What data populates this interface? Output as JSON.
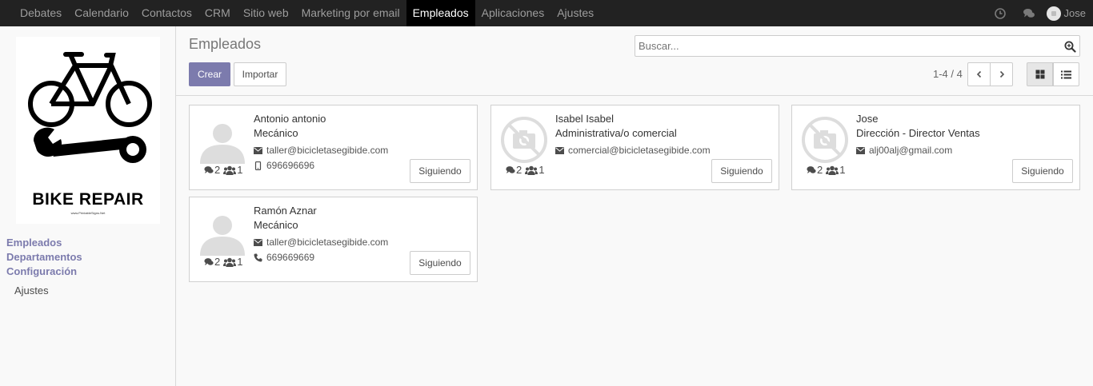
{
  "menu": [
    {
      "label": "Debates"
    },
    {
      "label": "Calendario"
    },
    {
      "label": "Contactos"
    },
    {
      "label": "CRM"
    },
    {
      "label": "Sitio web"
    },
    {
      "label": "Marketing por email"
    },
    {
      "label": "Empleados",
      "active": true
    },
    {
      "label": "Aplicaciones"
    },
    {
      "label": "Ajustes"
    }
  ],
  "topbar": {
    "user_name": "Jose",
    "icons": [
      "clock-icon",
      "chat-icon"
    ]
  },
  "logo": {
    "text": "BIKE REPAIR",
    "small": "www.PrintableSigns.Net"
  },
  "sidebar": {
    "sections": [
      "Empleados",
      "Departamentos",
      "Configuración"
    ],
    "sub_items": [
      "Ajustes"
    ]
  },
  "control": {
    "breadcrumb": "Empleados",
    "search_placeholder": "Buscar...",
    "create_label": "Crear",
    "import_label": "Importar",
    "pager": "1-4 / 4"
  },
  "colors": {
    "brand": "#7c7bad",
    "topbar": "#222222"
  },
  "employees": [
    {
      "name": "Antonio antonio",
      "job": "Mecánico",
      "email": "taller@bicicletasegibide.com",
      "phone": "696696696",
      "phone_icon": "mobile-icon",
      "messages": "2",
      "followers": "1",
      "follow_label": "Siguiendo",
      "photo": "person-silhouette"
    },
    {
      "name": "Isabel Isabel",
      "job": "Administrativa/o comercial",
      "email": "comercial@bicicletasegibide.com",
      "phone": "",
      "messages": "2",
      "followers": "1",
      "follow_label": "Siguiendo",
      "photo": "no-camera"
    },
    {
      "name": "Jose",
      "job": "Dirección - Director Ventas",
      "email": "alj00alj@gmail.com",
      "phone": "",
      "messages": "2",
      "followers": "1",
      "follow_label": "Siguiendo",
      "photo": "no-camera"
    },
    {
      "name": "Ramón Aznar",
      "job": "Mecánico",
      "email": "taller@bicicletasegibide.com",
      "phone": "669669669",
      "phone_icon": "phone-icon",
      "messages": "2",
      "followers": "1",
      "follow_label": "Siguiendo",
      "photo": "person-silhouette"
    }
  ]
}
